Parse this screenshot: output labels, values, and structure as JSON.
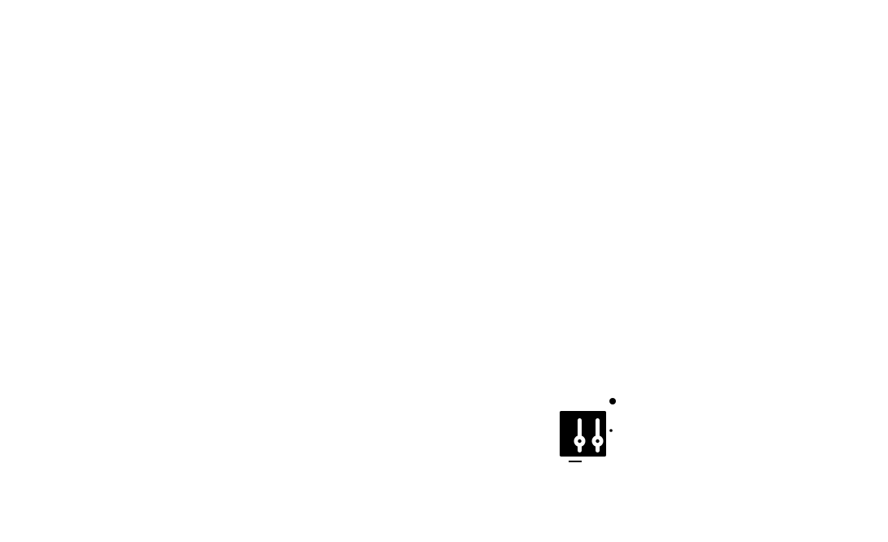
{
  "canvas": {
    "background": "#ffffff"
  },
  "icon": {
    "name": "equalizer-sliders-icon",
    "fill_color": "#000000",
    "knob_color": "#ffffff"
  }
}
